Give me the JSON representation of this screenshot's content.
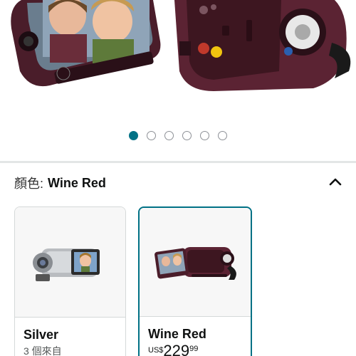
{
  "gallery": {
    "image_alt": "Wine Red camcorder with flip-out screen showing two children",
    "dot_count": 6,
    "active_index": 0
  },
  "color_selector": {
    "label": "顏色:",
    "selected_value": "Wine Red",
    "collapse_icon": "chevron-up-icon"
  },
  "swatches": [
    {
      "name": "Silver",
      "sub": "3 個來自"
    },
    {
      "name": "Wine Red",
      "currency": "US$",
      "whole": "229",
      "fraction": "99"
    }
  ],
  "colors": {
    "accent": "#007185",
    "wine": "#5b2333",
    "border": "#d5d9d9"
  }
}
